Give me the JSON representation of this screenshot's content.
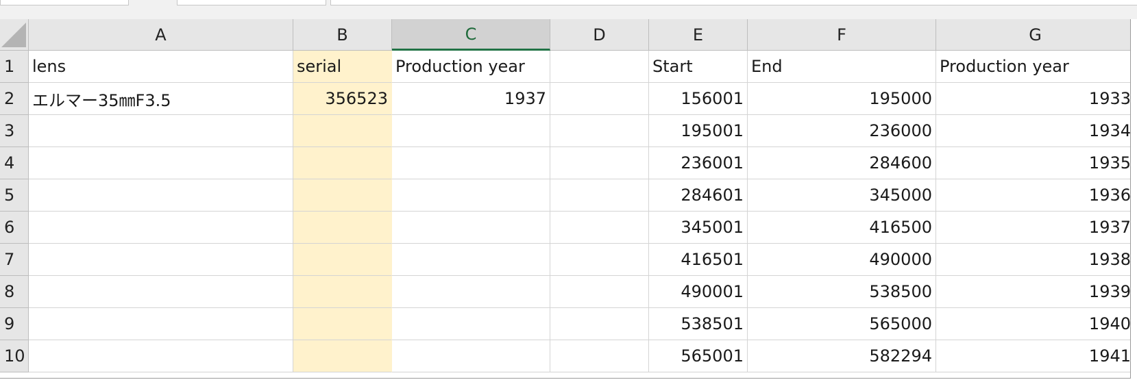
{
  "sheet": {
    "columns": [
      "A",
      "B",
      "C",
      "D",
      "E",
      "F",
      "G"
    ],
    "selected_column": "C",
    "highlight_column": "B",
    "highlight_color": "#fff2cc",
    "rows": [
      {
        "num": "1",
        "A": "lens",
        "B": "serial",
        "C": "Production year",
        "D": "",
        "E": "Start",
        "F": "End",
        "G": "Production year"
      },
      {
        "num": "2",
        "A": "エルマー35㎜F3.5",
        "B": "356523",
        "C": "1937",
        "D": "",
        "E": "156001",
        "F": "195000",
        "G": "1933"
      },
      {
        "num": "3",
        "A": "",
        "B": "",
        "C": "",
        "D": "",
        "E": "195001",
        "F": "236000",
        "G": "1934"
      },
      {
        "num": "4",
        "A": "",
        "B": "",
        "C": "",
        "D": "",
        "E": "236001",
        "F": "284600",
        "G": "1935"
      },
      {
        "num": "5",
        "A": "",
        "B": "",
        "C": "",
        "D": "",
        "E": "284601",
        "F": "345000",
        "G": "1936"
      },
      {
        "num": "6",
        "A": "",
        "B": "",
        "C": "",
        "D": "",
        "E": "345001",
        "F": "416500",
        "G": "1937"
      },
      {
        "num": "7",
        "A": "",
        "B": "",
        "C": "",
        "D": "",
        "E": "416501",
        "F": "490000",
        "G": "1938"
      },
      {
        "num": "8",
        "A": "",
        "B": "",
        "C": "",
        "D": "",
        "E": "490001",
        "F": "538500",
        "G": "1939"
      },
      {
        "num": "9",
        "A": "",
        "B": "",
        "C": "",
        "D": "",
        "E": "538501",
        "F": "565000",
        "G": "1940"
      },
      {
        "num": "10",
        "A": "",
        "B": "",
        "C": "",
        "D": "",
        "E": "565001",
        "F": "582294",
        "G": "1941"
      }
    ]
  }
}
